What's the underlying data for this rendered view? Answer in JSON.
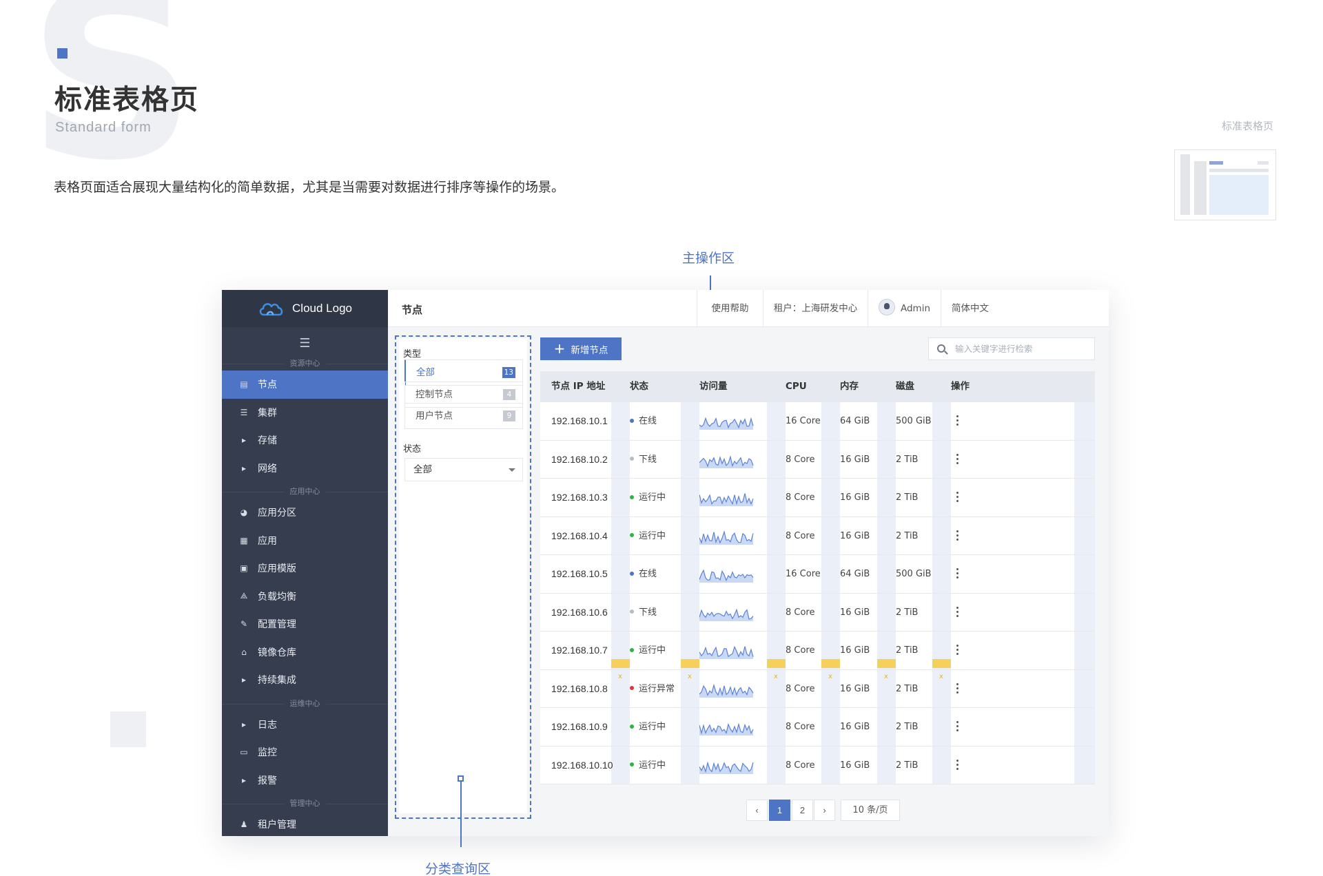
{
  "doc": {
    "big_letter": "S",
    "title": "标准表格页",
    "subtitle": "Standard form",
    "description": "表格页面适合展现大量结构化的简单数据，尤其是当需要对数据进行排序等操作的场景。",
    "thumb_label": "标准表格页",
    "annotation_main": "主操作区",
    "annotation_category": "分类查询区"
  },
  "app": {
    "logo_text": "Cloud Logo",
    "page_title": "节点",
    "topbar": {
      "help": "使用帮助",
      "tenant": "租户：上海研发中心",
      "user": "Admin",
      "language": "简体中文"
    },
    "sidebar": {
      "sections": [
        {
          "label": "资源中心",
          "items": [
            {
              "label": "节点",
              "icon": "server-icon",
              "active": true
            },
            {
              "label": "集群",
              "icon": "list-icon"
            },
            {
              "label": "存储",
              "icon": "caret-right-icon"
            },
            {
              "label": "网络",
              "icon": "caret-right-icon"
            }
          ]
        },
        {
          "label": "应用中心",
          "items": [
            {
              "label": "应用分区",
              "icon": "pie-icon"
            },
            {
              "label": "应用",
              "icon": "grid-icon"
            },
            {
              "label": "应用模版",
              "icon": "template-icon"
            },
            {
              "label": "负载均衡",
              "icon": "nodes-icon"
            },
            {
              "label": "配置管理",
              "icon": "wrench-icon"
            },
            {
              "label": "镜像仓库",
              "icon": "warehouse-icon"
            },
            {
              "label": "持续集成",
              "icon": "caret-right-icon"
            }
          ]
        },
        {
          "label": "运维中心",
          "items": [
            {
              "label": "日志",
              "icon": "caret-right-icon"
            },
            {
              "label": "监控",
              "icon": "monitor-icon"
            },
            {
              "label": "报警",
              "icon": "caret-right-icon"
            }
          ]
        },
        {
          "label": "管理中心",
          "items": [
            {
              "label": "租户管理",
              "icon": "users-icon"
            }
          ]
        }
      ]
    },
    "filter": {
      "type_label": "类型",
      "types": [
        {
          "label": "全部",
          "count": "13",
          "active": true
        },
        {
          "label": "控制节点",
          "count": "4"
        },
        {
          "label": "用户节点",
          "count": "9"
        }
      ],
      "status_label": "状态",
      "status_value": "全部"
    },
    "add_button": "新增节点",
    "search_placeholder": "输入关键字进行检索",
    "table": {
      "headers": [
        "节点 IP 地址",
        "状态",
        "访问量",
        "CPU",
        "内存",
        "磁盘",
        "操作"
      ],
      "rows": [
        {
          "ip": "192.168.10.1",
          "status": "在线",
          "status_color": "#4e74c6",
          "cpu": "16 Core",
          "mem": "64 GiB",
          "disk": "500 GiB"
        },
        {
          "ip": "192.168.10.2",
          "status": "下线",
          "status_color": "#b8bcc4",
          "cpu": "8 Core",
          "mem": "16 GiB",
          "disk": "2 TiB"
        },
        {
          "ip": "192.168.10.3",
          "status": "运行中",
          "status_color": "#2fb344",
          "cpu": "8 Core",
          "mem": "16 GiB",
          "disk": "2 TiB"
        },
        {
          "ip": "192.168.10.4",
          "status": "运行中",
          "status_color": "#2fb344",
          "cpu": "8 Core",
          "mem": "16 GiB",
          "disk": "2 TiB"
        },
        {
          "ip": "192.168.10.5",
          "status": "在线",
          "status_color": "#4e74c6",
          "cpu": "16 Core",
          "mem": "64 GiB",
          "disk": "500 GiB"
        },
        {
          "ip": "192.168.10.6",
          "status": "下线",
          "status_color": "#b8bcc4",
          "cpu": "8 Core",
          "mem": "16 GiB",
          "disk": "2 TiB"
        },
        {
          "ip": "192.168.10.7",
          "status": "运行中",
          "status_color": "#2fb344",
          "cpu": "8 Core",
          "mem": "16 GiB",
          "disk": "2 TiB"
        },
        {
          "ip": "192.168.10.8",
          "status": "运行异常",
          "status_color": "#e0333a",
          "cpu": "8 Core",
          "mem": "16 GiB",
          "disk": "2 TiB"
        },
        {
          "ip": "192.168.10.9",
          "status": "运行中",
          "status_color": "#2fb344",
          "cpu": "8 Core",
          "mem": "16 GiB",
          "disk": "2 TiB"
        },
        {
          "ip": "192.168.10.10",
          "status": "运行中",
          "status_color": "#2fb344",
          "cpu": "8 Core",
          "mem": "16 GiB",
          "disk": "2 TiB"
        }
      ]
    },
    "spacing_marker": "x",
    "pagination": {
      "prev": "‹",
      "pages": [
        "1",
        "2"
      ],
      "current": "1",
      "next": "›",
      "page_size": "10 条/页"
    },
    "colors": {
      "accent": "#4e74c6",
      "sidebar_bg": "#353d4f",
      "marker_yellow": "#f7cf5b"
    }
  }
}
